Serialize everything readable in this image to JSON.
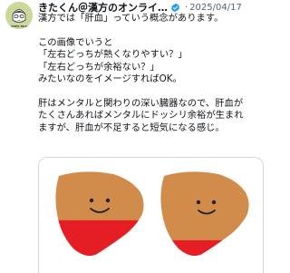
{
  "tweet": {
    "display_name": "きたくん＠漢方のオンライ…",
    "date": "2025/04/17",
    "separator": "·",
    "avatar_caption": "KAMPO TALKS",
    "lines": [
      "漢方では「肝血」っていう概念があります。",
      "",
      "この画像でいうと",
      "「左右どっちが熱くなりやすい？」",
      "「左右どっちが余裕ない？」",
      "みたいなのをイメージすればOK。",
      "",
      "肝はメンタルと関わりの深い臓器なので、肝血が",
      "たくさんあればメンタルにドッシリ余裕が生まれ",
      "ますが、肝血が不足すると短気になる感じ。"
    ]
  },
  "illustration": {
    "left_blood_level": 0.45,
    "right_blood_level": 0.22,
    "liver_color": "#d18c4c",
    "blood_color": "#e51e25"
  },
  "colors": {
    "verified_badge": "#1d9bf0",
    "avatar_bg": "#c9d99b"
  }
}
